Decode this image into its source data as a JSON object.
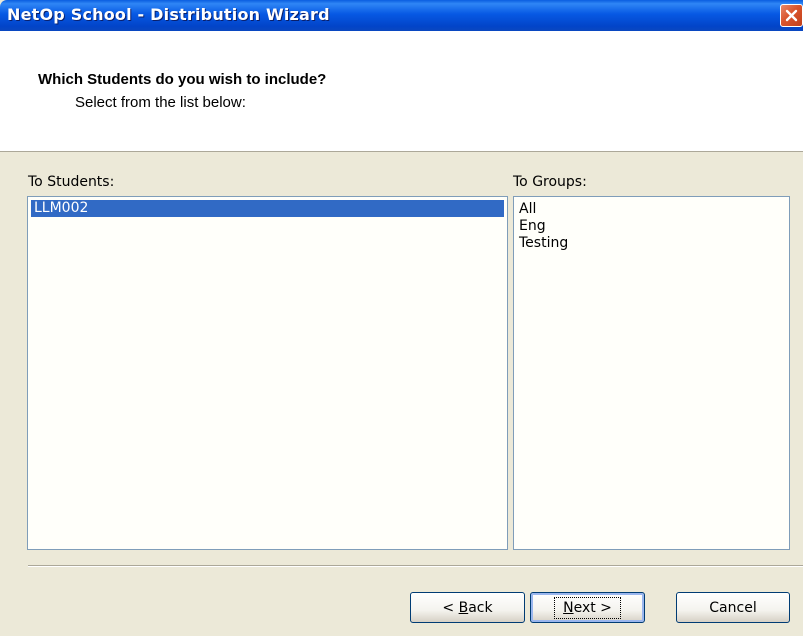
{
  "window": {
    "title": "NetOp School - Distribution Wizard"
  },
  "header": {
    "title": "Which Students do you wish to include?",
    "subtitle": "Select from the list below:"
  },
  "students": {
    "label": "To Students:",
    "items": [
      "LLM002"
    ],
    "selected_index": 0
  },
  "groups": {
    "label": "To Groups:",
    "items": [
      "All",
      "Eng",
      "Testing"
    ]
  },
  "buttons": {
    "back": {
      "prefix": "< ",
      "mnemonic": "B",
      "rest": "ack"
    },
    "next": {
      "mnemonic": "N",
      "rest": "ext >"
    },
    "cancel": "Cancel"
  },
  "colors": {
    "titlebar": "#0244c8",
    "selection": "#316ac5",
    "close_button": "#d9542c"
  }
}
